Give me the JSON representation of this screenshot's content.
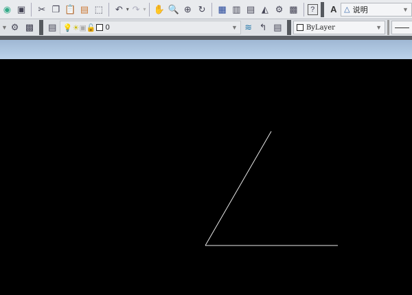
{
  "toolbar1": {
    "icons": [
      "open-icon",
      "save-icon",
      "cut-icon",
      "copy-icon",
      "paste-icon",
      "match-properties-icon",
      "block-editor-icon",
      "undo-icon",
      "redo-icon",
      "pan-icon",
      "zoom-realtime-icon",
      "zoom-window-icon",
      "zoom-previous-icon",
      "properties-icon",
      "design-center-icon",
      "tool-palettes-icon",
      "sheet-set-icon",
      "markup-icon",
      "calculator-icon",
      "help-icon"
    ],
    "text_style_value": "说明"
  },
  "toolbar2": {
    "layer_value": "0",
    "color_value": "ByLayer"
  },
  "canvas": {
    "background": "#000000",
    "line_color": "#e8e8e8"
  }
}
